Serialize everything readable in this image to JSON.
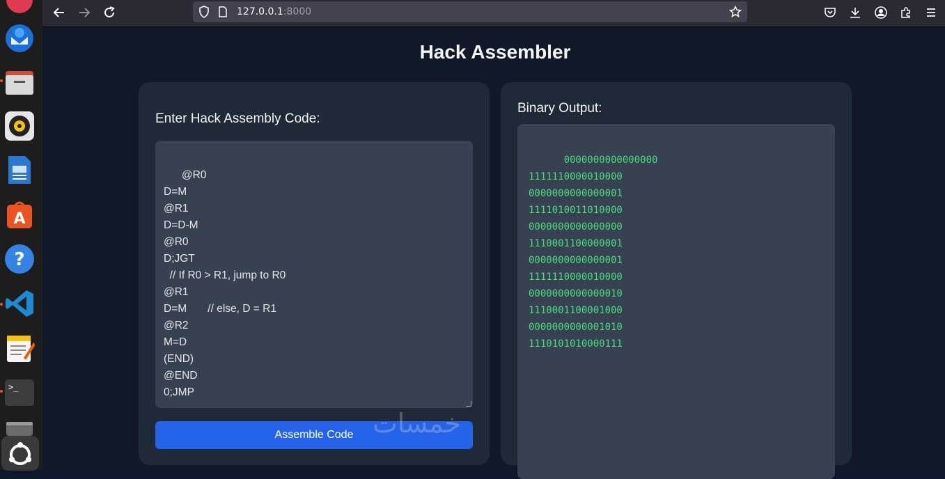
{
  "browser": {
    "url_host": "127.0.0.1",
    "url_port": ":8000"
  },
  "dock": {
    "apps": [
      "firefox-icon",
      "thunderbird-icon",
      "files-icon",
      "rhythmbox-icon",
      "libreoffice-writer-icon",
      "app-center-icon",
      "help-icon",
      "vscode-icon",
      "text-editor-icon",
      "terminal-icon",
      "drive-icon",
      "ubuntu-logo-icon"
    ]
  },
  "page": {
    "title": "Hack Assembler",
    "input_label": "Enter Hack Assembly Code:",
    "code": "@R0\nD=M\n@R1\nD=D-M\n@R0\nD;JGT\n  // If R0 > R1, jump to R0\n@R1\nD=M       // else, D = R1\n@R2\nM=D\n(END)\n@END\n0;JMP",
    "assemble_button": "Assemble Code",
    "output_label": "Binary Output:",
    "binary_output": "0000000000000000\n1111110000010000\n0000000000000001\n1111010011010000\n0000000000000000\n1110001100000001\n0000000000000001\n1111110000010000\n0000000000000010\n1110001100001000\n0000000000001010\n1110101010000111"
  },
  "watermark": "خمسات",
  "colors": {
    "button": "#2563eb",
    "binary_text": "#4ade80",
    "background": "#111827"
  }
}
